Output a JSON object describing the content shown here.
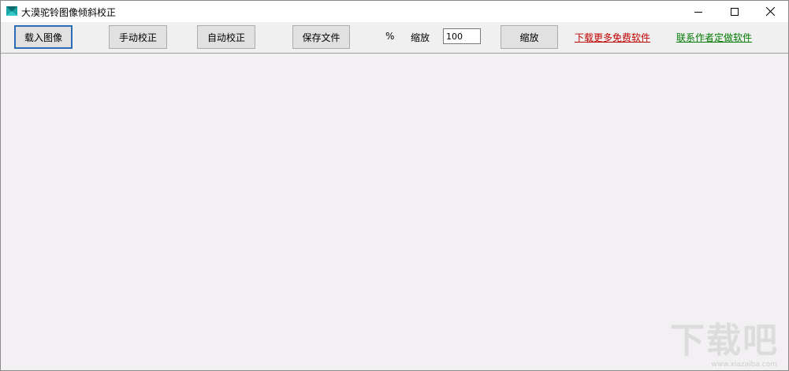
{
  "window": {
    "title": "大漠驼铃图像倾斜校正",
    "controls": {
      "minimize": "minimize",
      "maximize": "maximize",
      "close": "close"
    }
  },
  "toolbar": {
    "load_label": "载入图像",
    "manual_label": "手动校正",
    "auto_label": "自动校正",
    "save_label": "保存文件",
    "percent_label": "%",
    "zoom_label": "缩放",
    "zoom_value": "100",
    "zoom_button_label": "缩放",
    "download_link": "下载更多免费软件",
    "contact_link": "联系作者定做软件"
  },
  "watermark": {
    "main": "下载吧",
    "sub": "www.xiazaiba.com"
  },
  "colors": {
    "download_link": "#c00000",
    "contact_link": "#007a00",
    "default_button_border": "#2d6db5",
    "canvas_bg": "#f2f0f2"
  }
}
